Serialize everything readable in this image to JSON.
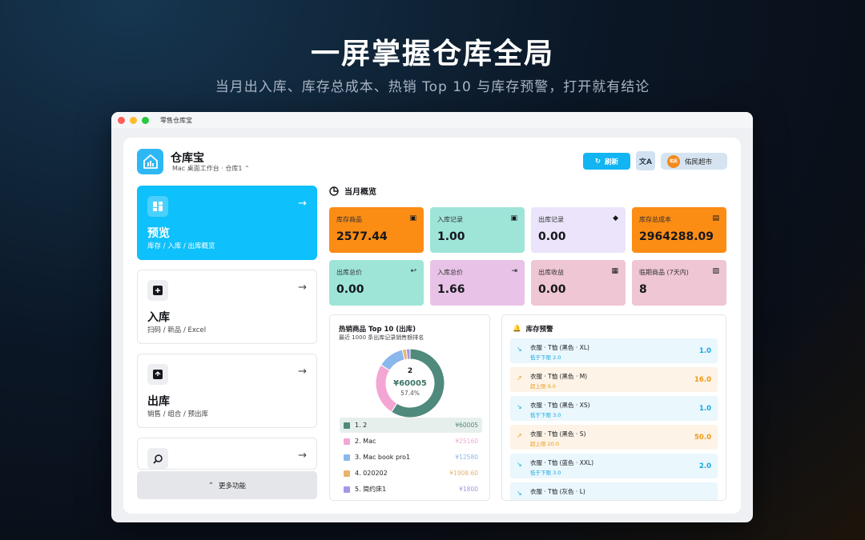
{
  "hero": {
    "title": "一屏掌握仓库全局",
    "subtitle": "当月出入库、库存总成本、热销 Top 10 与库存预警，打开就有结论"
  },
  "window": {
    "title": "零售仓库宝"
  },
  "header": {
    "app_name": "仓库宝",
    "location": "Mac 桌面工作台 · 仓库1 ⌃",
    "refresh_label": "刷新",
    "lang_glyph": "文A",
    "store_avatar": "佑民",
    "store_name": "佑民超市"
  },
  "nav": [
    {
      "title": "预览",
      "desc": "库存 / 入库 / 出库概览",
      "active": true
    },
    {
      "title": "入库",
      "desc": "扫码 / 新品 / Excel",
      "active": false
    },
    {
      "title": "出库",
      "desc": "销售 / 组合 / 预出库",
      "active": false
    }
  ],
  "more_label": "更多功能",
  "overview": {
    "title": "当月概览",
    "stats": [
      {
        "label": "库存商品",
        "value": "2577.44",
        "color": "#fb8c14"
      },
      {
        "label": "入库记录",
        "value": "1.00",
        "color": "#9ee5d8"
      },
      {
        "label": "出库记录",
        "value": "0.00",
        "color": "#ebe4fb"
      },
      {
        "label": "库存总成本",
        "value": "2964288.09",
        "color": "#fb8c14"
      },
      {
        "label": "出库总价",
        "value": "0.00",
        "color": "#9ee5d8"
      },
      {
        "label": "入库总价",
        "value": "1.66",
        "color": "#e8c3e7"
      },
      {
        "label": "出库收益",
        "value": "0.00",
        "color": "#efc6d3"
      },
      {
        "label": "临期商品 (7天内)",
        "value": "8",
        "color": "#efc6d3"
      }
    ]
  },
  "top10": {
    "title": "热销商品 Top 10 (出库)",
    "subtitle": "最近 1000 条出库记录销售额排名",
    "center_name": "2",
    "center_value": "¥60005",
    "center_percent": "57.4%",
    "items": [
      {
        "label": "1. 2",
        "amount": "¥60005",
        "color": "#4f8a7c"
      },
      {
        "label": "2. Mac",
        "amount": "¥25160",
        "color": "#f3a6d4"
      },
      {
        "label": "3. Mac book pro1",
        "amount": "¥12580",
        "color": "#8ab7ec"
      },
      {
        "label": "4. 020202",
        "amount": "¥1908.60",
        "color": "#e9b36a"
      },
      {
        "label": "5. 简约床1",
        "amount": "¥1800",
        "color": "#a795e8"
      }
    ]
  },
  "chart_data": {
    "type": "pie",
    "categories": [
      "2",
      "Mac",
      "Mac book pro1",
      "020202",
      "简约床1"
    ],
    "values": [
      60005,
      25160,
      12580,
      1908.6,
      1800
    ],
    "title": "热销商品 Top 10 (出库)",
    "donut": true
  },
  "alerts": {
    "title": "库存预警",
    "items": [
      {
        "name": "衣服 · T恤 (黑色 · XL)",
        "hint": "低于下限 2.0",
        "value": "1.0",
        "kind": "low"
      },
      {
        "name": "衣服 · T恤 (黑色 · M)",
        "hint": "超上限 9.0",
        "value": "16.0",
        "kind": "high"
      },
      {
        "name": "衣服 · T恤 (黑色 · XS)",
        "hint": "低于下限 3.0",
        "value": "1.0",
        "kind": "low"
      },
      {
        "name": "衣服 · T恤 (黑色 · S)",
        "hint": "超上限 20.0",
        "value": "50.0",
        "kind": "high"
      },
      {
        "name": "衣服 · T恤 (蓝色 · XXL)",
        "hint": "低于下限 3.0",
        "value": "2.0",
        "kind": "low"
      },
      {
        "name": "衣服 · T恤 (灰色 · L)",
        "hint": "",
        "value": "",
        "kind": "low"
      }
    ]
  }
}
